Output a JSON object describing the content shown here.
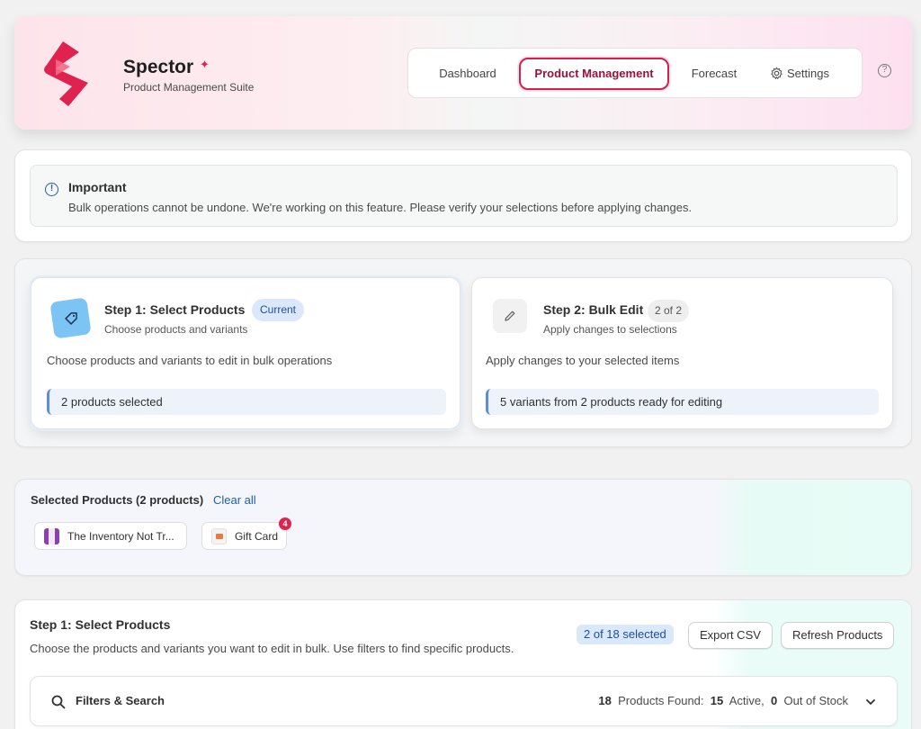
{
  "header": {
    "brand_name": "Spector",
    "brand_sub": "Product Management Suite",
    "nav": [
      {
        "label": "Dashboard"
      },
      {
        "label": "Product Management"
      },
      {
        "label": "Forecast"
      },
      {
        "label": "Settings"
      }
    ],
    "help_icon_glyph": "?"
  },
  "banner": {
    "title": "Important",
    "text": "Bulk operations cannot be undone. We're working on this feature. Please verify your selections before applying changes.",
    "icon_glyph": "!"
  },
  "steps": [
    {
      "title": "Step 1: Select Products",
      "badge": "Current",
      "subtitle": "Choose products and variants",
      "description": "Choose products and variants to edit in bulk operations",
      "status": "2 products selected",
      "icon": "tag-icon"
    },
    {
      "title": "Step 2: Bulk Edit",
      "badge": "2 of 2",
      "subtitle": "Apply changes to selections",
      "description": "Apply changes to your selected items",
      "status": "5 variants from 2 products ready for editing",
      "icon": "pencil-icon"
    }
  ],
  "selected": {
    "title": "Selected Products (2 products)",
    "clear_label": "Clear all",
    "chips": [
      {
        "label": "The Inventory Not Tr..."
      },
      {
        "label": "Gift Card",
        "badge": "4"
      }
    ]
  },
  "select_panel": {
    "title": "Step 1: Select Products",
    "subtitle": "Choose the products and variants you want to edit in bulk. Use filters to find specific products.",
    "count_pill": "2 of 18 selected",
    "export_label": "Export CSV",
    "refresh_label": "Refresh Products",
    "filters": {
      "title": "Filters & Search",
      "found_count": "18",
      "found_label": "Products Found:",
      "active_count": "15",
      "active_label": "Active,",
      "oos_count": "0",
      "oos_label": "Out of Stock"
    }
  },
  "colors": {
    "brand": "#e0224e",
    "accent_blue": "#1d5fa8",
    "active_nav_border": "#d61f4d"
  }
}
